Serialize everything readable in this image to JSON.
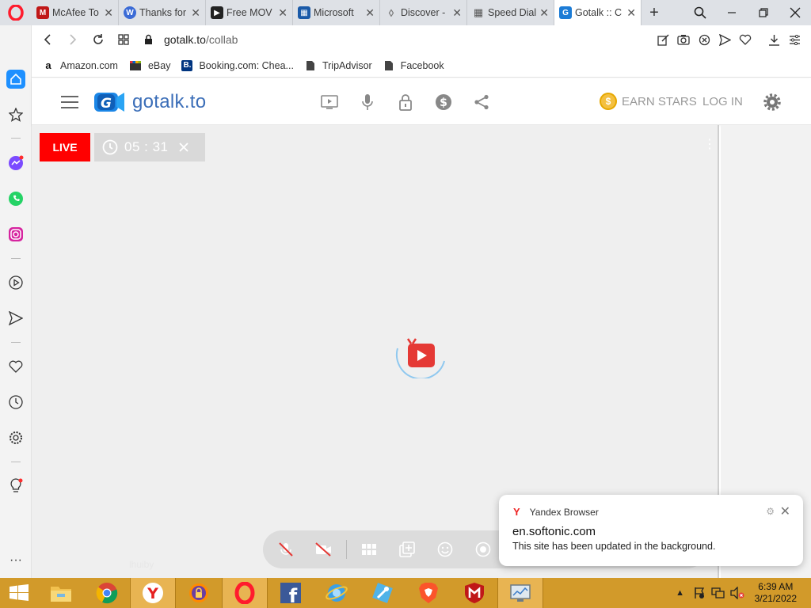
{
  "browser": {
    "tabs": [
      {
        "title": "McAfee To",
        "icon": "mcafee-icon",
        "color": "#c01818"
      },
      {
        "title": "Thanks for",
        "icon": "wordpress-icon",
        "color": "#3b6bd6"
      },
      {
        "title": "Free MOV",
        "icon": "film-icon",
        "color": "#222222"
      },
      {
        "title": "Microsoft",
        "icon": "microsoft-icon",
        "color": "#1a5aa8"
      },
      {
        "title": "Discover -",
        "icon": "drop-icon",
        "color": "#666666"
      },
      {
        "title": "Speed Dial",
        "icon": "grid-icon",
        "color": "#555555"
      },
      {
        "title": "Gotalk :: C",
        "icon": "gotalk-icon",
        "color": "#1c7cd6",
        "active": true
      }
    ],
    "url_host": "gotalk.to",
    "url_path": "/collab",
    "bookmarks": [
      "Amazon.com",
      "eBay",
      "Booking.com: Chea...",
      "TripAdvisor",
      "Facebook"
    ]
  },
  "site": {
    "logo_text": "gotalk.to",
    "earn_stars": "EARN STARS",
    "login": "LOG IN",
    "accent": "#3b6eb8"
  },
  "stage": {
    "live_label": "LIVE",
    "timer": "05 : 31",
    "watermark": "lhuiby"
  },
  "notification": {
    "app": "Yandex Browser",
    "heading": "en.softonic.com",
    "body": "This site has been updated in the background."
  },
  "taskbar": {
    "time": "6:39 AM",
    "date": "3/21/2022"
  }
}
